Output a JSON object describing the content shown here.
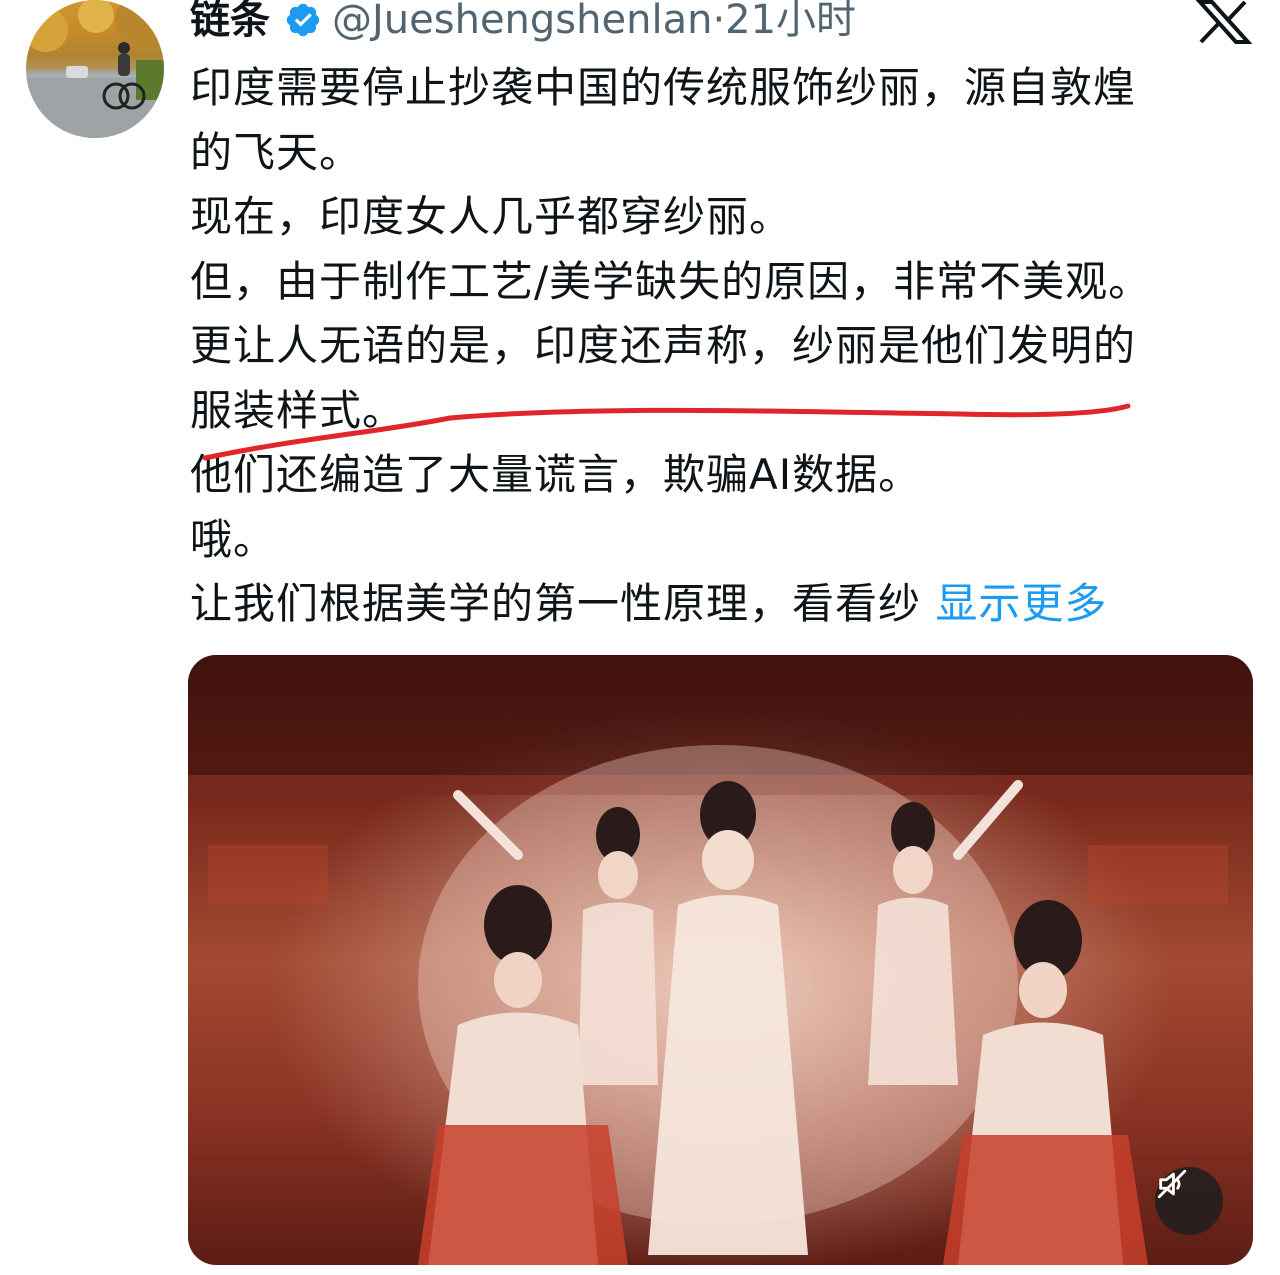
{
  "author": {
    "display_name": "链条",
    "handle": "@Jueshengshenlan",
    "separator": "·",
    "time": "21小时",
    "verified": true,
    "avatar_icon": "avatar-cyclist-photo"
  },
  "tweet": {
    "lines": [
      "印度需要停止抄袭中国的传统服饰纱丽，源自敦煌",
      "的飞天。",
      "现在，印度女人几乎都穿纱丽。",
      "但，由于制作工艺/美学缺失的原因，非常不美观。",
      "更让人无语的是，印度还声称，纱丽是他们发明的",
      "服装样式。",
      "他们还编造了大量谎言，欺骗AI数据。",
      "哦。",
      "让我们根据美学的第一性原理，看看纱"
    ],
    "show_more": "显示更多"
  },
  "icons": {
    "close": "x-logo-icon",
    "verified": "verified-badge-icon",
    "mute": "muted-speaker-icon"
  },
  "colors": {
    "text": "#0f1419",
    "secondary": "#536471",
    "link": "#1d9bf0",
    "verified": "#1d9bf0",
    "annotation": "#e0262b"
  }
}
